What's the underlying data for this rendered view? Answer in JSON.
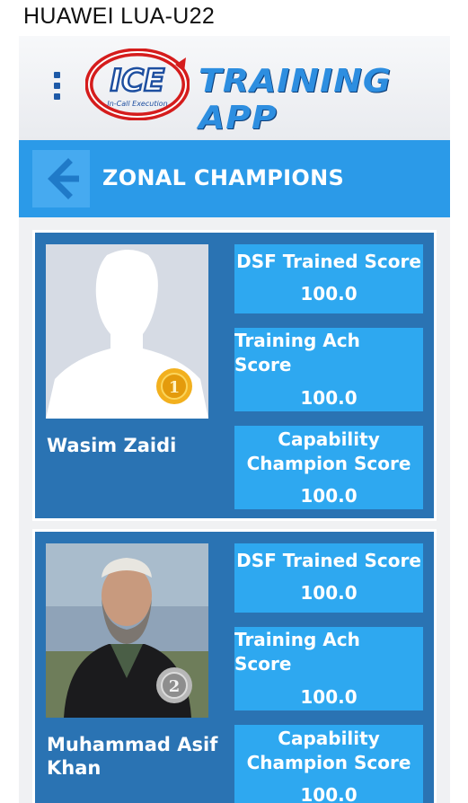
{
  "status_bar": {
    "device": "HUAWEI LUA-U22"
  },
  "header": {
    "logo_text": "ICE",
    "logo_tagline": "In-Call Execution",
    "app_title": "TRAINING APP",
    "menu_icon": "kebab-menu-icon"
  },
  "title_bar": {
    "back_icon": "arrow-left-icon",
    "title": "ZONAL CHAMPIONS"
  },
  "champions": [
    {
      "name": "Wasim Zaidi",
      "rank_badge": "1",
      "photo": "placeholder-avatar",
      "scores": [
        {
          "label": "DSF Trained Score",
          "value": "100.0"
        },
        {
          "label": "Training Ach Score",
          "value": "100.0"
        },
        {
          "label": "Capability Champion Score",
          "value": "100.0"
        }
      ]
    },
    {
      "name": "Muhammad Asif Khan",
      "rank_badge": "2",
      "photo": "person-photo",
      "scores": [
        {
          "label": "DSF Trained Score",
          "value": "100.0"
        },
        {
          "label": "Training Ach Score",
          "value": "100.0"
        },
        {
          "label": "Capability Champion Score",
          "value": "100.0"
        }
      ]
    }
  ],
  "colors": {
    "title_bar": "#2b9ae8",
    "card": "#2a73b3",
    "score_box": "#2ea8f0",
    "gold_medal": "#f2b01e",
    "silver_medal": "#b7b7b7"
  }
}
